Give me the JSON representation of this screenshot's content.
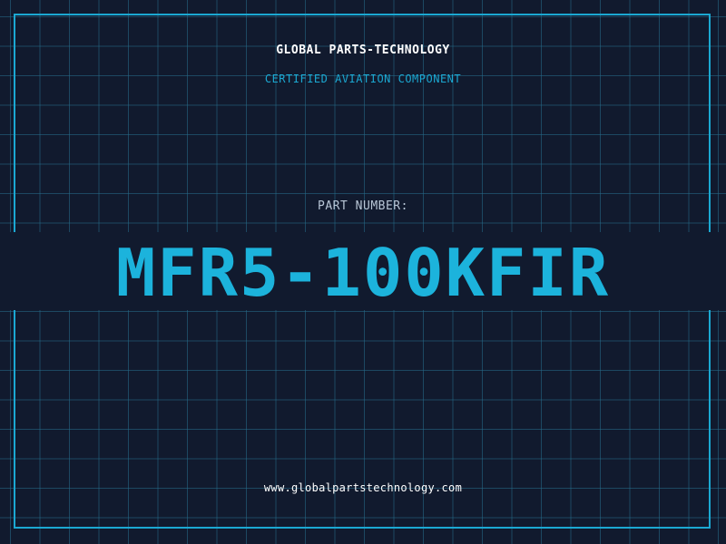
{
  "company_name": "GLOBAL PARTS-TECHNOLOGY",
  "certification": "CERTIFIED AVIATION COMPONENT",
  "part_number_label": "PART NUMBER:",
  "part_number": "MFR5-100KFIR",
  "website": "www.globalpartstechnology.com",
  "colors": {
    "background": "#111a2e",
    "accent": "#1ba8d2",
    "grid": "#266e8c",
    "text": "#ffffff"
  }
}
